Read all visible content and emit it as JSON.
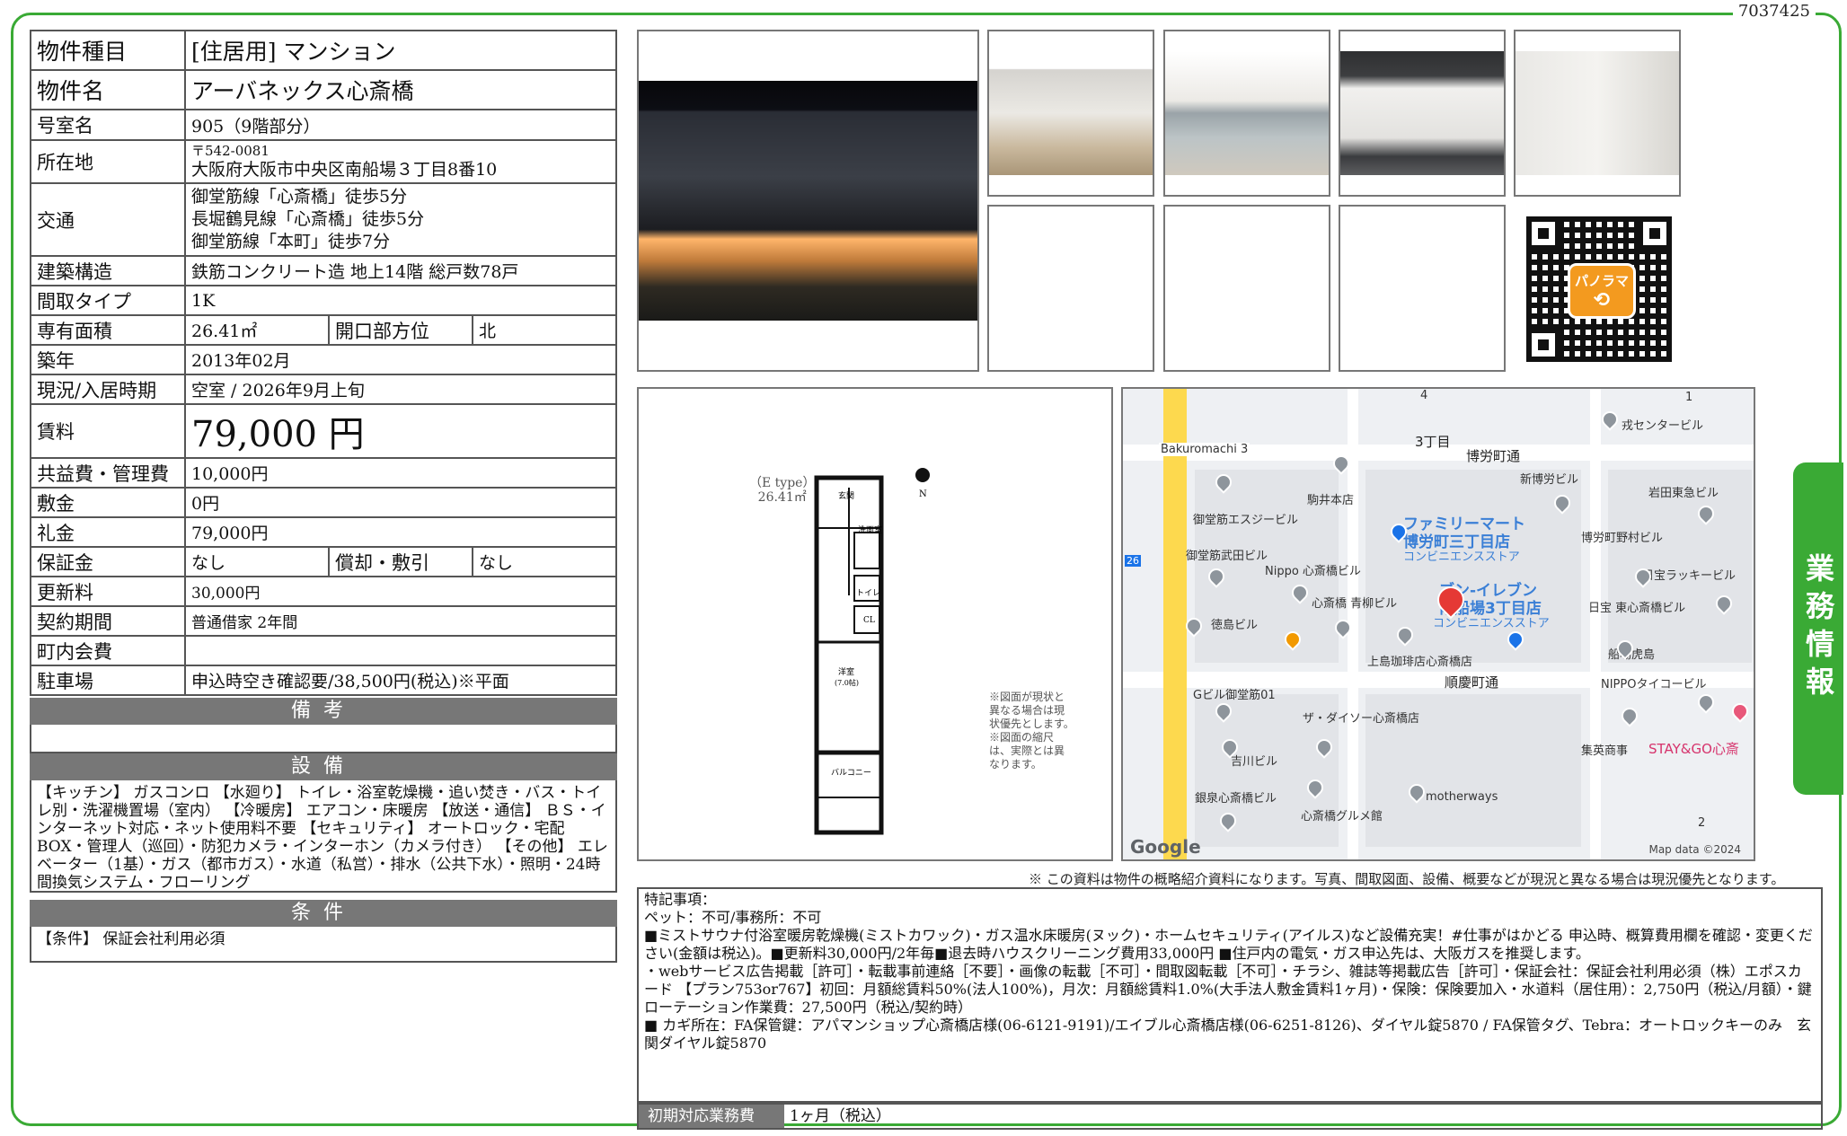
{
  "doc_id": "7037425",
  "side_tab": "業務情報",
  "rows": {
    "type": {
      "k": "物件種目",
      "v": "[住居用]  マンション"
    },
    "name": {
      "k": "物件名",
      "v": "アーバネックス心斎橋"
    },
    "room": {
      "k": "号室名",
      "v": "905（9階部分）"
    },
    "address": {
      "k": "所在地",
      "postal": "〒542-0081",
      "v": "大阪府大阪市中央区南船場３丁目8番10"
    },
    "access": {
      "k": "交通",
      "lines": [
        "御堂筋線「心斎橋」徒歩5分",
        "長堀鶴見線「心斎橋」徒歩5分",
        "御堂筋線「本町」徒歩7分"
      ]
    },
    "structure": {
      "k": "建築構造",
      "v": "鉄筋コンクリート造 地上14階 総戸数78戸"
    },
    "layout": {
      "k": "間取タイプ",
      "v": "1K"
    },
    "area": {
      "k": "専有面積",
      "v": "26.41㎡",
      "k2": "開口部方位",
      "v2": "北"
    },
    "built": {
      "k": "築年",
      "v": "2013年02月"
    },
    "status": {
      "k": "現況/入居時期",
      "v": "空室  /   2026年9月上旬"
    },
    "rent": {
      "k": "賃料",
      "v": "79,000 円"
    },
    "common": {
      "k": "共益費・管理費",
      "v": "10,000円"
    },
    "deposit": {
      "k": "敷金",
      "v": "0円"
    },
    "key_money": {
      "k": "礼金",
      "v": "79,000円"
    },
    "guarantee": {
      "k": "保証金",
      "v": "なし",
      "k2": "償却・敷引",
      "v2": "なし"
    },
    "renewal": {
      "k": "更新料",
      "v": "30,000円"
    },
    "contract": {
      "k": "契約期間",
      "v": "普通借家  2年間"
    },
    "town_fee": {
      "k": "町内会費",
      "v": ""
    },
    "parking": {
      "k": "駐車場",
      "v": "申込時空き確認要/38,500円(税込)※平面"
    }
  },
  "remarks_header": "備考",
  "remarks_body": "",
  "equipment_header": "設備",
  "equipment_text": "【キッチン】 ガスコンロ 【水廻り】 トイレ・浴室乾燥機・追い焚き・バス・トイレ別・洗濯機置場（室内） 【冷暖房】 エアコン・床暖房 【放送・通信】 ＢＳ・インターネット対応・ネット使用料不要 【セキュリティ】 オートロック・宅配BOX・管理人（巡回）・防犯カメラ・インターホン（カメラ付き） 【その他】 エレベーター（1基）・ガス（都市ガス）・水道（私営）・排水（公共下水）・照明・24時間換気システム・フローリング",
  "conditions_header": "条件",
  "conditions_text": "【条件】 保証会社利用必須",
  "floorplan": {
    "type_label": "（E type）",
    "area": "26.41㎡",
    "rooms": [
      "玄関",
      "洗面室",
      "トイレ",
      "CL",
      "洋室",
      "(7.0帖)",
      "バルコニー"
    ],
    "north": "N",
    "note": "※図面が現状と異なる場合は現状優先とします。※図面の縮尺は、実際とは異なります。"
  },
  "map": {
    "labels": {
      "bakuromachi": "Bakuromachi 3",
      "chome": "3丁目",
      "hakuromachi_dori": "博労町通",
      "num4": "4",
      "num1": "1",
      "num2": "2",
      "num26": "26",
      "inui": "戎センタービル",
      "shinhakuro": "新博労ビル",
      "iwata": "岩田東急ビル",
      "komai": "駒井本店",
      "midosuji_s": "御堂筋エスジービル",
      "fm1": "ファミリーマート",
      "fm2": "博労町三丁目店",
      "fm3": "コンビニエンスストア",
      "hakuro_nomura": "博労町野村ビル",
      "midosuji_takeda": "御堂筋武田ビル",
      "nippo": "Nippo 心斎橋ビル",
      "nichiho": "日宝ラッキービル",
      "se1": "ブン-イレブン",
      "se2": "南船場3丁目店",
      "se3": "コンビニエンスストア",
      "aoyagi": "心斎橋 青柳ビル",
      "nichiho_higashi": "日宝 東心斎橋ビル",
      "tokushima": "徳島ビル",
      "ueshima": "上島珈琲店心斎橋店",
      "funaba_tora": "船場虎島",
      "junkei": "順慶町通",
      "g_midosuji": "Gビル御堂筋01",
      "daiso": "ザ・ダイソー心斎橋店",
      "nippo_tower": "NIPPOタイコービル",
      "yoshikawa": "吉川ビル",
      "shueisha": "集英商事",
      "staygo": "STAY&GO心斎",
      "ginsho": "銀泉心斎橋ビル",
      "shinsai_gourmet": "心斎橋グルメ館",
      "motherways": "motherways",
      "google": "Google",
      "mapdata": "Map data ©2024"
    }
  },
  "disclaimer": "※ この資料は物件の概略紹介資料になります。写真、間取図面、設備、概要などが現況と異なる場合は現況優先となります。",
  "remarks_box": {
    "lines": [
      "特記事項：",
      "ペット：不可/事務所：不可",
      "■ミストサウナ付浴室暖房乾燥機(ミストカワック)・ガス温水床暖房(ヌック)・ホームセキュリティ(アイルス)など設備充実！#仕事がはかどる 申込時、概算費用欄を確認・変更ください(金額は税込)。■更新料30,000円/2年毎■退去時ハウスクリーニング費用33,000円 ■住戸内の電気・ガス申込先は、大阪ガスを推奨します。",
      "・webサービス広告掲載［許可］・転載事前連絡［不要］・画像の転載［不可］・間取図転載［不可］・チラシ、雑誌等掲載広告［許可］・保証会社：保証会社利用必須（株）エポスカード 【プラン753or767】初回：月額総賃料50%(法人100%)，月次：月額総賃料1.0%(大手法人敷金賃料1ヶ月)・保険：保険要加入・水道料（居住用）：2,750円（税込/月額）・鍵ローテーション作業費：27,500円（税込/契約時）",
      "■ カギ所在：FA保管鍵：アパマンショップ心斎橋店様(06-6121-9191)/エイブル心斎橋店様(06-6251-8126)、ダイヤル錠5870 / FA保管タグ、Tebra：オートロックキーのみ　玄関ダイヤル錠5870"
    ]
  },
  "initial_fee": {
    "label": "初期対応業務費",
    "value": "1ヶ月（税込）"
  },
  "qr_badge": "パノラマ"
}
